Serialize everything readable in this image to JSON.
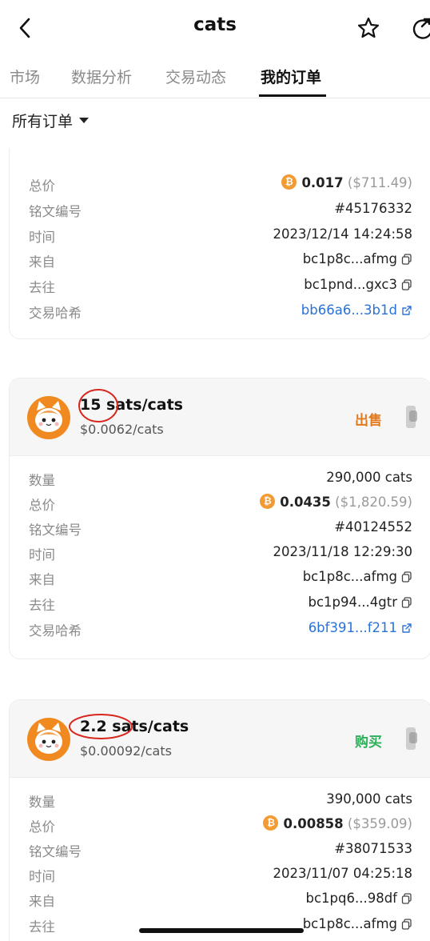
{
  "header": {
    "title": "cats",
    "back_icon": "chevron-left-icon",
    "star_icon": "star-outline-icon",
    "share_icon": "share-icon"
  },
  "tabs": [
    {
      "label": "市场"
    },
    {
      "label": "数据分析"
    },
    {
      "label": "交易动态"
    },
    {
      "label": "我的订单",
      "active": true
    }
  ],
  "filter": {
    "label": "所有订单"
  },
  "labels": {
    "quantity": "数量",
    "total": "总价",
    "inscription": "铭文编号",
    "time": "时间",
    "from": "来自",
    "to": "去往",
    "hash": "交易哈希"
  },
  "orders": [
    {
      "total_btc": "0.017",
      "total_usd": "($711.49)",
      "inscription": "#45176332",
      "time": "2023/12/14 14:24:58",
      "from": "bc1p8c...afmg",
      "to": "bc1pnd...gxc3",
      "hash": "bb66a6...3b1d"
    },
    {
      "price": "15 sats/cats",
      "usd_unit": "$0.0062/cats",
      "side": "出售",
      "quantity": "290,000 cats",
      "total_btc": "0.0435",
      "total_usd": "($1,820.59)",
      "inscription": "#40124552",
      "time": "2023/11/18 12:29:30",
      "from": "bc1p8c...afmg",
      "to": "bc1p94...4gtr",
      "hash": "6bf391...f211"
    },
    {
      "price": "2.2 sats/cats",
      "usd_unit": "$0.00092/cats",
      "side": "购买",
      "quantity": "390,000 cats",
      "total_btc": "0.00858",
      "total_usd": "($359.09)",
      "inscription": "#38071533",
      "time": "2023/11/07 04:25:18",
      "from": "bc1pq6...98df",
      "to": "bc1p8c...afmg"
    }
  ],
  "colors": {
    "sell": "#e07a1f",
    "buy": "#2fae5a",
    "link": "#2a72d8",
    "btc": "#f39a32",
    "annotation_ring": "#d9261c"
  }
}
